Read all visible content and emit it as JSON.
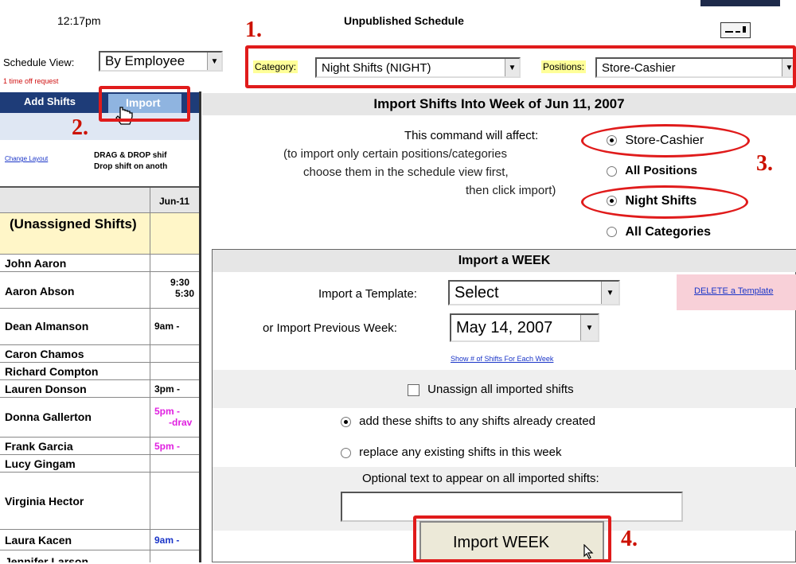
{
  "header": {
    "time": "12:17pm",
    "schedule_title": "Unpublished Schedule"
  },
  "schedule_view": {
    "label": "Schedule View:",
    "value": "By Employee",
    "time_off_note": "1 time off request"
  },
  "filters": {
    "category_label": "Category:",
    "category_value": "Night Shifts (NIGHT)",
    "positions_label": "Positions:",
    "positions_value": "Store-Cashier"
  },
  "toolbar": {
    "add_shifts": "Add Shifts",
    "import": "Import"
  },
  "layout_hint": {
    "change_layout": "Change Layout",
    "line1": "DRAG & DROP shif",
    "line2": "Drop shift on anoth"
  },
  "table": {
    "date_header": "Jun-11",
    "unassigned": "(Unassigned Shifts)",
    "rows": [
      {
        "name": "John Aaron",
        "cell": ""
      },
      {
        "name": "Aaron Abson",
        "cell": "9:30",
        "cell2": "5:30"
      },
      {
        "name": "Dean Almanson",
        "cell": "9am -"
      },
      {
        "name": "Caron Chamos",
        "cell": ""
      },
      {
        "name": "Richard Compton",
        "cell": ""
      },
      {
        "name": "Lauren Donson",
        "cell": "3pm -"
      },
      {
        "name": "Donna Gallerton",
        "cell": "5pm -",
        "cell2": "-drav"
      },
      {
        "name": "Frank Garcia",
        "cell": "5pm -"
      },
      {
        "name": "Lucy Gingam",
        "cell": ""
      },
      {
        "name": "Virginia Hector",
        "cell": ""
      },
      {
        "name": "Laura Kacen",
        "cell": "9am -"
      },
      {
        "name": "Jennifer Larson",
        "cell": ""
      }
    ]
  },
  "import_dialog": {
    "title": "Import Shifts Into Week of Jun 11, 2007",
    "affect_line": "This command will affect:",
    "hint_line1": "(to import only certain positions/categories",
    "hint_line2": "choose them in the schedule view first,",
    "hint_line3": "then click import)",
    "opt_store_cashier": "Store-Cashier",
    "opt_all_positions": "All Positions",
    "opt_night_shifts": "Night Shifts",
    "opt_all_categories": "All Categories"
  },
  "import_week": {
    "title": "Import a WEEK",
    "template_label": "Import a Template:",
    "template_value": "Select",
    "delete_template": "DELETE a Template",
    "prev_week_label": "or Import Previous Week:",
    "prev_week_value": "May 14, 2007",
    "show_shifts_link": "Show # of Shifts For Each Week",
    "unassign_label": "Unassign all imported shifts",
    "add_label": "add these shifts to any shifts already created",
    "replace_label": "replace any existing shifts in this week",
    "optional_text_label": "Optional text to appear on all imported shifts:",
    "optional_text_value": "",
    "import_button": "Import WEEK"
  },
  "annotations": {
    "step1": "1.",
    "step2": "2.",
    "step3": "3.",
    "step4": "4."
  },
  "colors": {
    "annotation_red": "#e01b1b",
    "toolbar_blue": "#1e3c78",
    "filter_yellow": "#ffff99",
    "name_highlight": "#fff6c8",
    "pink": "#f8d0d8",
    "link_blue": "#1a35c8",
    "magenta_shift": "#e020e0"
  }
}
